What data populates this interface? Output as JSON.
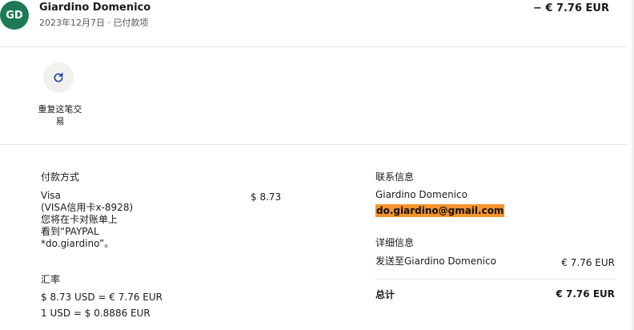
{
  "header": {
    "avatar_initials": "GD",
    "merchant_name": "Giardino Domenico",
    "date_status": "2023年12月7日 · 已付款项",
    "amount": "− € 7.76 EUR"
  },
  "actions": {
    "repeat_label": "重复这笔交易",
    "repeat_icon": "refresh-icon"
  },
  "payment_method": {
    "title": "付款方式",
    "lines": [
      "Visa",
      "(VISA信用卡x-8928)",
      "您将在卡对账单上",
      "看到“PAYPAL",
      "*do.giardino”。"
    ],
    "amount": "$ 8.73"
  },
  "exchange_rate": {
    "title": "汇率",
    "line1": "$ 8.73 USD = € 7.76 EUR",
    "line2": "1 USD = $ 0.8886 EUR"
  },
  "contact": {
    "title": "联系信息",
    "name": "Giardino Domenico",
    "email": "do.giardino@gmail.com"
  },
  "details": {
    "title": "详细信息",
    "sent_to_label": "发送至Giardino Domenico",
    "sent_to_amount": "€ 7.76 EUR",
    "total_label": "总计",
    "total_amount": "€ 7.76 EUR"
  },
  "colors": {
    "avatar_bg": "#1d7a55",
    "email_highlight": "#f5932c",
    "icon_blue": "#1f3fa8"
  }
}
